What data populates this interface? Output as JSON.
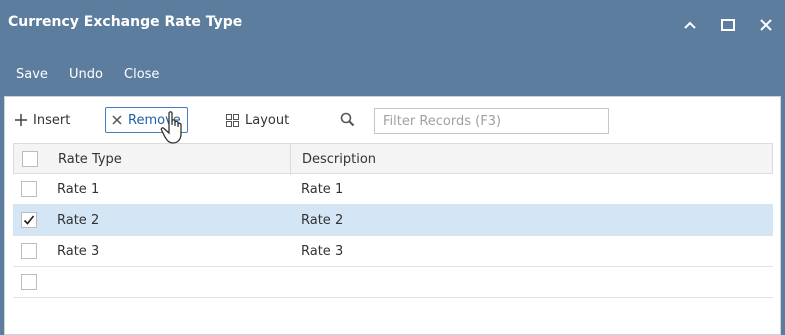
{
  "window": {
    "title": "Currency Exchange Rate Type",
    "controls": [
      "minimize-icon",
      "maximize-icon",
      "close-icon"
    ]
  },
  "menu": {
    "save": "Save",
    "undo": "Undo",
    "close": "Close"
  },
  "toolbar": {
    "insert": "Insert",
    "remove": "Remove",
    "layout": "Layout",
    "filter_placeholder": "Filter Records (F3)"
  },
  "grid": {
    "columns": [
      "Rate Type",
      "Description"
    ],
    "rows": [
      {
        "rate_type": "Rate 1",
        "description": "Rate 1",
        "checked": false
      },
      {
        "rate_type": "Rate 2",
        "description": "Rate 2",
        "checked": true
      },
      {
        "rate_type": "Rate 3",
        "description": "Rate 3",
        "checked": false
      }
    ]
  },
  "colors": {
    "titlebar": "#5d7d9e",
    "selected_row": "#d4e5f5",
    "active_button_border": "#3d80c4"
  }
}
